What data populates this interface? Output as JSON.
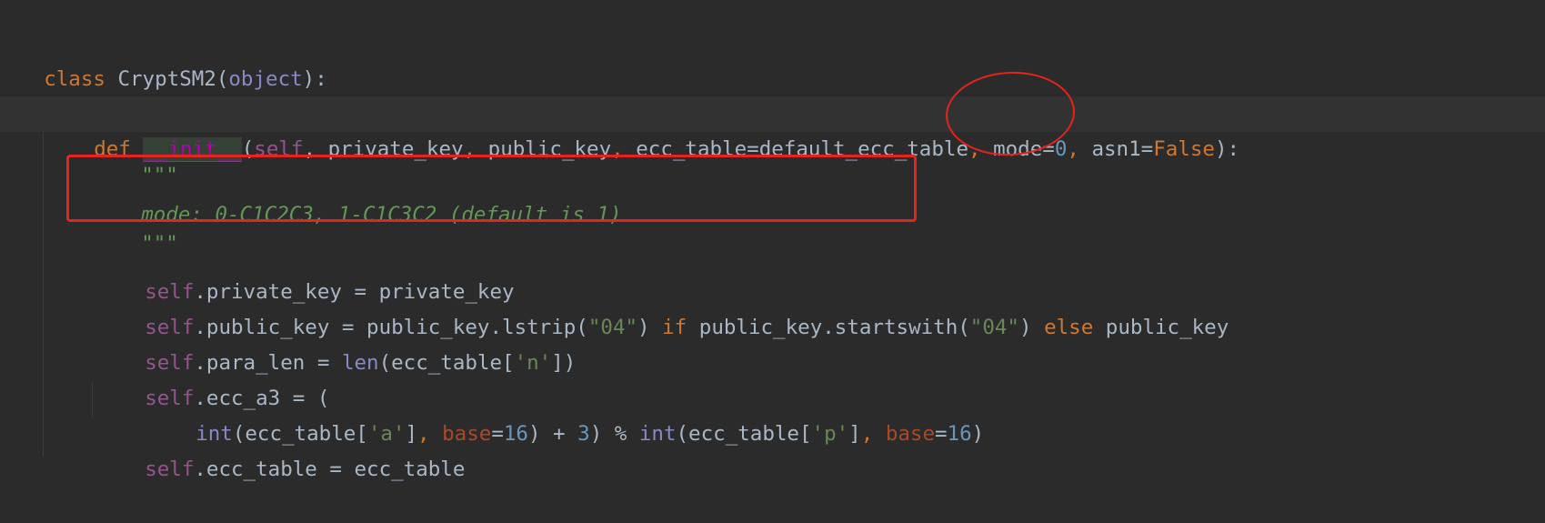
{
  "editor": {
    "language": "python",
    "lines": {
      "l1": [
        "class",
        " CryptSM2(",
        "object",
        "):"
      ],
      "l2": [
        "def",
        " ",
        "__init__",
        "(",
        "self",
        ", private_key",
        ",",
        " public_key",
        ",",
        " ecc_table=default_ecc_table",
        ",",
        " mode=",
        "0",
        ",",
        " asn1=",
        "False",
        "):"
      ],
      "l3": [
        "\"\"\""
      ],
      "l4": [
        "mode: 0-C1C2C3, 1-C1C3C2 (default is 1)"
      ],
      "l5": [
        "\"\"\""
      ],
      "l6": [
        "self",
        ".private_key = private_key"
      ],
      "l7": [
        "self",
        ".public_key = public_key.lstrip(",
        "\"04\"",
        ") ",
        "if",
        " public_key.startswith(",
        "\"04\"",
        ") ",
        "else",
        " public_key"
      ],
      "l8": [
        "self",
        ".para_len = ",
        "len",
        "(ecc_table[",
        "'n'",
        "])"
      ],
      "l9": [
        "self",
        ".ecc_a3 = ("
      ],
      "l10": [
        "int",
        "(ecc_table[",
        "'a'",
        "]",
        ",",
        " ",
        "base",
        "=",
        "16",
        ") + ",
        "3",
        ") % ",
        "int",
        "(ecc_table[",
        "'p'",
        "]",
        ",",
        " ",
        "base",
        "=",
        "16",
        ")"
      ],
      "l11": [
        "self",
        ".ecc_table = ecc_table"
      ]
    }
  },
  "annotations": {
    "rect_color": "#e5231f",
    "ellipse_color": "#e5231f"
  }
}
